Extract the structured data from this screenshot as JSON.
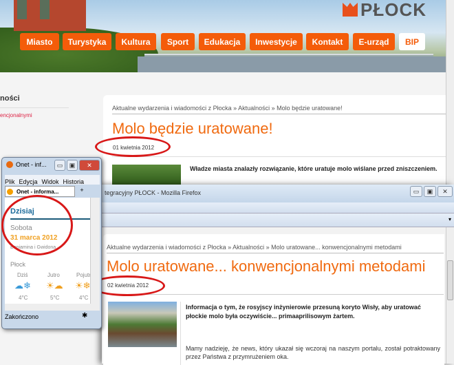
{
  "site": {
    "logo": "PŁOCK",
    "nav": [
      "Miasto",
      "Turystyka",
      "Kultura",
      "Sport",
      "Edukacja",
      "Inwestycje",
      "Kontakt",
      "E-urząd",
      "BIP"
    ],
    "sidebar": {
      "title": "ności",
      "link": "encjonalnymi"
    }
  },
  "article1": {
    "breadcrumb": "Aktualne wydarzenia i wiadomości z Płocka » Aktualności » Molo będzie uratowane!",
    "title": "Molo będzie uratowane!",
    "date": "01 kwietnia 2012",
    "lead": "Władze miasta znalazły rozwiązanie, które uratuje molo wiślane przed zniszczeniem."
  },
  "window2": {
    "title": "tegracyjny PŁOCK - Mozilla Firefox",
    "article": {
      "breadcrumb": "Aktualne wydarzenia i wiadomości z Płocka » Aktualności » Molo uratowane... konwencjonalnymi metodami",
      "title": "Molo uratowane... konwencjonalnymi metodami",
      "date": "02 kwietnia 2012",
      "lead": "Informacja o tym, że rosyjscy inżynierowie przesuną koryto Wisły, aby uratować płockie molo była oczywiście... primaaprilisowym żartem.",
      "paragraph": "Mamy nadzieję, że news, który ukazał się wczoraj na naszym portalu, został potraktowany przez Państwa z przymrużeniem oka."
    }
  },
  "window1": {
    "title": "Onet - inf...",
    "menu": [
      "Plik",
      "Edycja",
      "Widok",
      "Historia"
    ],
    "tab": "Onet - informa...",
    "heading": "Dzisiaj",
    "weekday": "Sobota",
    "date": "31 marca 2012",
    "names": "Beniamina i Gwidona",
    "city": "Płock",
    "forecast": [
      {
        "day": "Dziś",
        "temp": "4°C"
      },
      {
        "day": "Jutro",
        "temp": "5°C"
      },
      {
        "day": "Pojutr",
        "temp": "4°C"
      }
    ],
    "status": "Zakończono"
  },
  "colors": {
    "accent": "#f06a10",
    "nav": "#f45c0a",
    "annotation": "#d81818",
    "onet_heading": "#1a6a9a",
    "onet_date": "#f0a020"
  }
}
